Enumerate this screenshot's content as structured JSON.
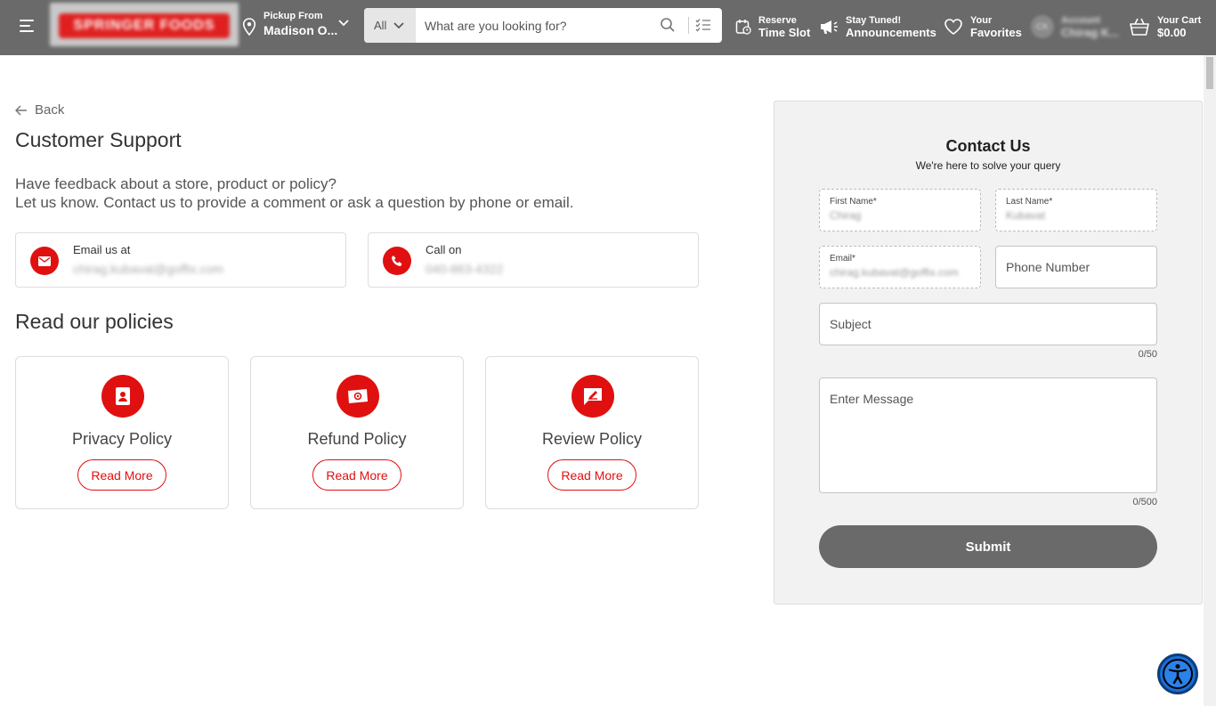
{
  "header": {
    "logo_text": "SPRINGER FOODS",
    "pickup": {
      "small": "Pickup From",
      "store": "Madison O..."
    },
    "search": {
      "category": "All",
      "placeholder": "What are you looking for?"
    },
    "reserve": {
      "line1": "Reserve",
      "line2": "Time Slot"
    },
    "stay": {
      "line1": "Stay Tuned!",
      "line2": "Announcements"
    },
    "favorites": {
      "line1": "Your",
      "line2": "Favorites"
    },
    "account": {
      "avatar": "CK",
      "line1": "Account",
      "line2": "Chirag K..."
    },
    "cart": {
      "line1": "Your Cart",
      "line2": "$0.00"
    }
  },
  "main": {
    "back_label": "Back",
    "title": "Customer Support",
    "intro_line1": "Have feedback about a store, product or policy?",
    "intro_line2": "Let us know. Contact us to provide a comment or ask a question by phone or email.",
    "email_card": {
      "label": "Email us at",
      "value": "chirag.kubavat@goffix.com"
    },
    "phone_card": {
      "label": "Call on",
      "value": "040-863-4322"
    },
    "policies_title": "Read our policies",
    "policies": [
      {
        "name": "Privacy Policy",
        "button": "Read More"
      },
      {
        "name": "Refund Policy",
        "button": "Read More"
      },
      {
        "name": "Review Policy",
        "button": "Read More"
      }
    ]
  },
  "form": {
    "title": "Contact Us",
    "subtitle": "We're here to solve your query",
    "first_name": {
      "label": "First Name*",
      "value": "Chirag"
    },
    "last_name": {
      "label": "Last Name*",
      "value": "Kubavat"
    },
    "email": {
      "label": "Email*",
      "value": "chirag.kubavat@goffix.com"
    },
    "phone": {
      "placeholder": "Phone Number"
    },
    "subject": {
      "placeholder": "Subject",
      "counter": "0/50"
    },
    "message": {
      "placeholder": "Enter Message",
      "counter": "0/500"
    },
    "submit_label": "Submit"
  },
  "colors": {
    "header_bg": "#6a6a6a",
    "accent": "#e01010",
    "panel_bg": "#f2f2f2",
    "submit_bg": "#6a6a6a",
    "a11y": "#1a6fd8"
  }
}
